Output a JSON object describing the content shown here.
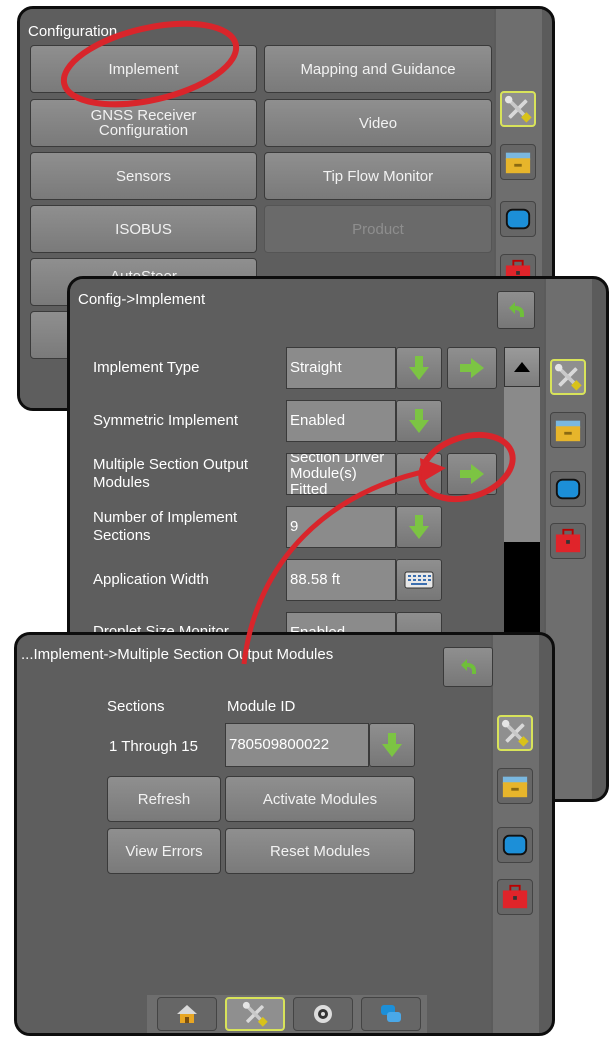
{
  "back_panel": {
    "title": "Configuration",
    "buttons": {
      "implement": "Implement",
      "mapping": "Mapping and Guidance",
      "gnss": "GNSS Receiver Configuration",
      "video": "Video",
      "sensors": "Sensors",
      "tip_flow": "Tip Flow Monitor",
      "isobus": "ISOBUS",
      "product": "Product",
      "autosteer": "AutoSteer"
    }
  },
  "mid_panel": {
    "title": "Config->Implement",
    "rows": [
      {
        "label": "Implement Type",
        "value": "Straight"
      },
      {
        "label": "Symmetric Implement",
        "value": "Enabled"
      },
      {
        "label": "Multiple Section Output Modules",
        "value": "Section Driver Module(s) Fitted"
      },
      {
        "label": "Number of Implement Sections",
        "value": "9"
      },
      {
        "label": "Application Width",
        "value": "88.58 ft"
      },
      {
        "label": "Droplet Size Monitor",
        "value": "Enabled"
      }
    ]
  },
  "front_panel": {
    "title": "...Implement->Multiple Section Output Modules",
    "sections_header": "Sections",
    "module_header": "Module ID",
    "sections_value": "1 Through 15",
    "module_value": "780509800022",
    "buttons": {
      "refresh": "Refresh",
      "activate": "Activate Modules",
      "view_errors": "View Errors",
      "reset": "Reset Modules"
    }
  },
  "colors": {
    "highlight": "#d9252b",
    "arrow_green": "#7cc443",
    "tab_select": "#d8e35a"
  },
  "icons": [
    "tools-icon",
    "folder-icon",
    "screen-icon",
    "toolbox-icon",
    "home-icon",
    "back-arrow-icon",
    "gps-icon",
    "layers-icon"
  ]
}
